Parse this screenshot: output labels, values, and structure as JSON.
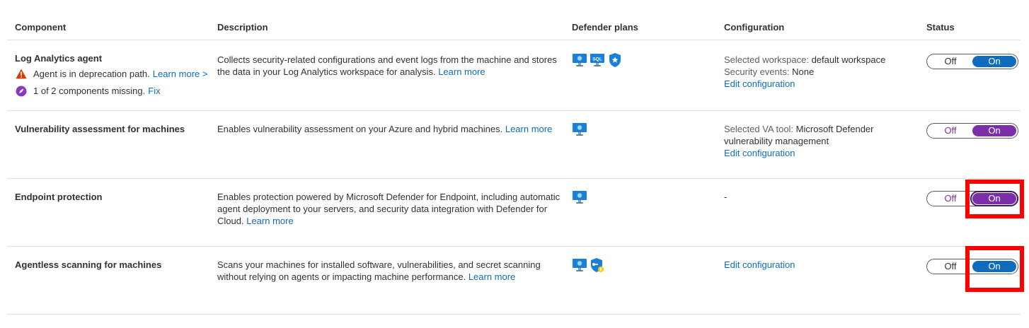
{
  "headers": {
    "component": "Component",
    "description": "Description",
    "plans": "Defender plans",
    "configuration": "Configuration",
    "status": "Status"
  },
  "rows": [
    {
      "name": "Log Analytics agent",
      "warning_text": "Agent is in deprecation path.",
      "warning_link": "Learn more >",
      "missing_text": "1 of 2 components missing.",
      "missing_link": "Fix",
      "desc_lines": [
        "Collects security-related configurations and event logs from the machine and stores",
        "the data in your Log Analytics workspace for analysis."
      ],
      "desc_link": "Learn more",
      "plan_icons": [
        "server-icon",
        "sql-server-icon",
        "shield-star-icon"
      ],
      "config_label1": "Selected workspace:",
      "config_value1": "default workspace",
      "config_label2": "Security events:",
      "config_value2": "None",
      "config_link": "Edit configuration",
      "toggle_off": "Off",
      "toggle_on": "On",
      "toggle_state": "On"
    },
    {
      "name": "Vulnerability assessment for machines",
      "desc_lines": [
        "Enables vulnerability assessment on your Azure and hybrid machines."
      ],
      "desc_link": "Learn more",
      "plan_icons": [
        "server-icon"
      ],
      "config_label1": "Selected VA tool:",
      "config_value1": "Microsoft Defender",
      "config_value1b": "vulnerability management",
      "config_link": "Edit configuration",
      "toggle_off": "Off",
      "toggle_on": "On",
      "toggle_state": "On"
    },
    {
      "name": "Endpoint protection",
      "desc_lines": [
        "Enables protection powered by Microsoft Defender for Endpoint, including automatic",
        "agent deployment to your servers, and security data integration with Defender for",
        "Cloud."
      ],
      "desc_link": "Learn more",
      "plan_icons": [
        "server-icon"
      ],
      "config_dash": "-",
      "toggle_off": "Off",
      "toggle_on": "On",
      "toggle_state": "On"
    },
    {
      "name": "Agentless scanning for machines",
      "desc_lines": [
        "Scans your machines for installed software, vulnerabilities, and secret scanning",
        "without relying on agents or impacting machine performance."
      ],
      "desc_link": "Learn more",
      "plan_icons": [
        "server-icon",
        "shield-key-icon"
      ],
      "config_link": "Edit configuration",
      "toggle_off": "Off",
      "toggle_on": "On",
      "toggle_state": "On"
    }
  ],
  "colors": {
    "link": "#0f6cbd",
    "toggle_blue": "#0f6cbd",
    "toggle_purple": "#7c2fa8",
    "highlight": "#ff0000",
    "warning": "#d83b01"
  }
}
